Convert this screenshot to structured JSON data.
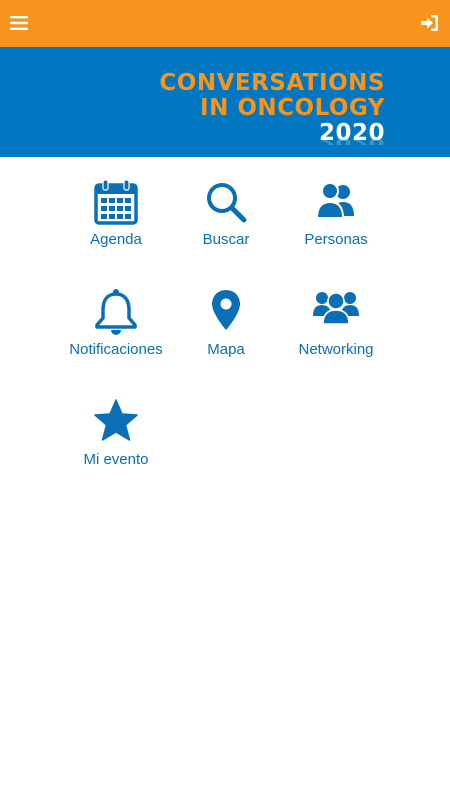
{
  "header": {
    "menu_icon": "hamburger-menu-icon",
    "login_icon": "sign-in-icon"
  },
  "banner": {
    "line1": "CONVERSATIONS",
    "line2": "IN ONCOLOGY",
    "year": "2020"
  },
  "tiles": [
    {
      "label": "Agenda",
      "icon": "calendar-icon"
    },
    {
      "label": "Buscar",
      "icon": "search-icon"
    },
    {
      "label": "Personas",
      "icon": "people-icon"
    },
    {
      "label": "Notificaciones",
      "icon": "bell-icon"
    },
    {
      "label": "Mapa",
      "icon": "map-pin-icon"
    },
    {
      "label": "Networking",
      "icon": "group-icon"
    },
    {
      "label": "Mi evento",
      "icon": "star-icon"
    }
  ],
  "colors": {
    "topbar": "#f7941d",
    "banner": "#0077c0",
    "accent": "#0a6fb5"
  }
}
